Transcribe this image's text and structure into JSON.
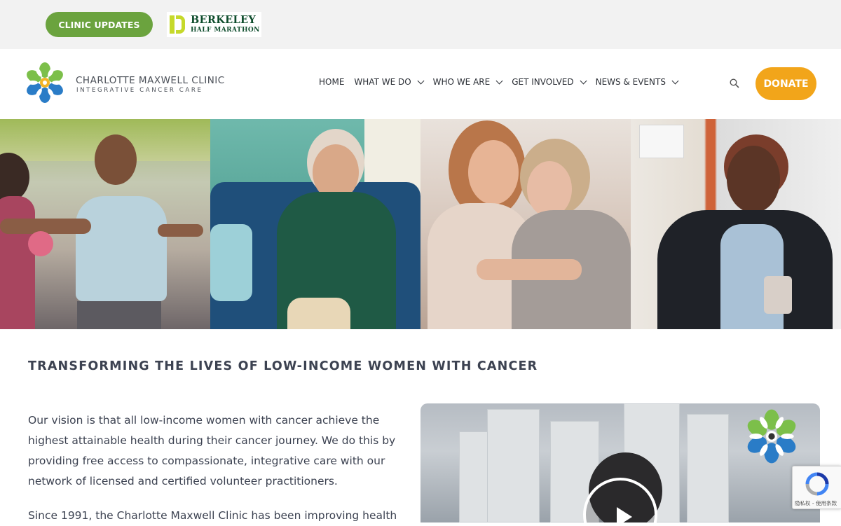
{
  "topbar": {
    "clinic_updates_label": "CLINIC UPDATES",
    "sponsor_logo_line1": "BERKELEY",
    "sponsor_logo_line2": "HALF MARATHON"
  },
  "header": {
    "logo_name": "CHARLOTTE MAXWELL CLINIC",
    "logo_tagline": "INTEGRATIVE CANCER CARE",
    "nav": [
      {
        "label": "HOME",
        "has_dropdown": false
      },
      {
        "label": "WHAT WE DO",
        "has_dropdown": true
      },
      {
        "label": "WHO WE ARE",
        "has_dropdown": true
      },
      {
        "label": "GET INVOLVED",
        "has_dropdown": true
      },
      {
        "label": "NEWS & EVENTS",
        "has_dropdown": true
      }
    ],
    "search_icon": "search-icon",
    "donate_label": "DONATE"
  },
  "hero": {
    "panels": [
      "exercise-class-photo",
      "seated-elder-patient-photo",
      "embracing-women-photo",
      "smiling-woman-at-clinic-photo"
    ]
  },
  "main": {
    "headline": "TRANSFORMING THE LIVES OF LOW-INCOME WOMEN WITH CANCER",
    "vision_paragraph": "Our vision is that all low-income women with cancer achieve the highest attainable health during their cancer journey. We do this by providing free access to compassionate, integrative care with our network of licensed and certified volunteer practitioners.",
    "since_paragraph": "Since 1991, the Charlotte Maxwell Clinic has been improving health",
    "video": {
      "play_icon": "play-icon"
    }
  },
  "recaptcha": {
    "label": "隐私权 - 使用条款"
  },
  "colors": {
    "green": "#6ba33e",
    "orange": "#f2a51a",
    "text": "#3c4251",
    "topbar_bg": "#f2f2f2"
  }
}
